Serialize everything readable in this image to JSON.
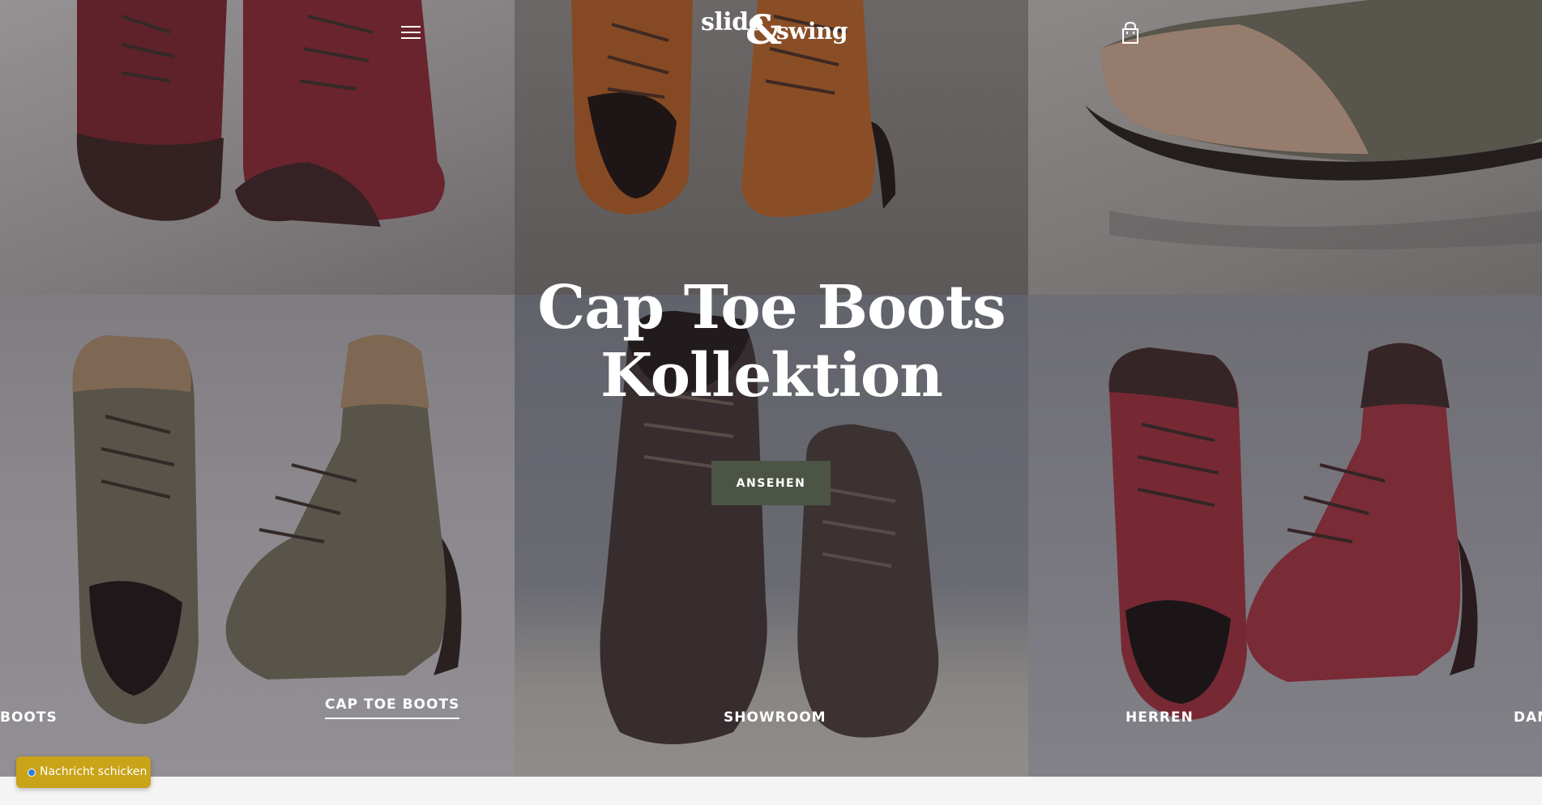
{
  "header": {
    "logo_word1": "slide",
    "logo_amp": "&",
    "logo_word2": "swing"
  },
  "hero": {
    "title_line1": "Cap Toe Boots",
    "title_line2": "Kollektion",
    "cta_label": "ANSEHEN"
  },
  "nav": {
    "items": [
      {
        "label": "BOOTS"
      },
      {
        "label": "CAP TOE BOOTS",
        "active": true
      },
      {
        "label": "SHOWROOM"
      },
      {
        "label": "HERREN"
      },
      {
        "label": "DAM"
      }
    ]
  },
  "chat": {
    "label": "Nachricht schicken"
  },
  "colors": {
    "cta_bg": "#4c5446",
    "chat_bg": "#c9a318",
    "chat_dot": "#2f7fe0",
    "text": "#ffffff"
  },
  "icons": {
    "menu": "hamburger-menu-icon",
    "cart": "shopping-bag-icon",
    "chat_status": "online-dot-icon"
  }
}
